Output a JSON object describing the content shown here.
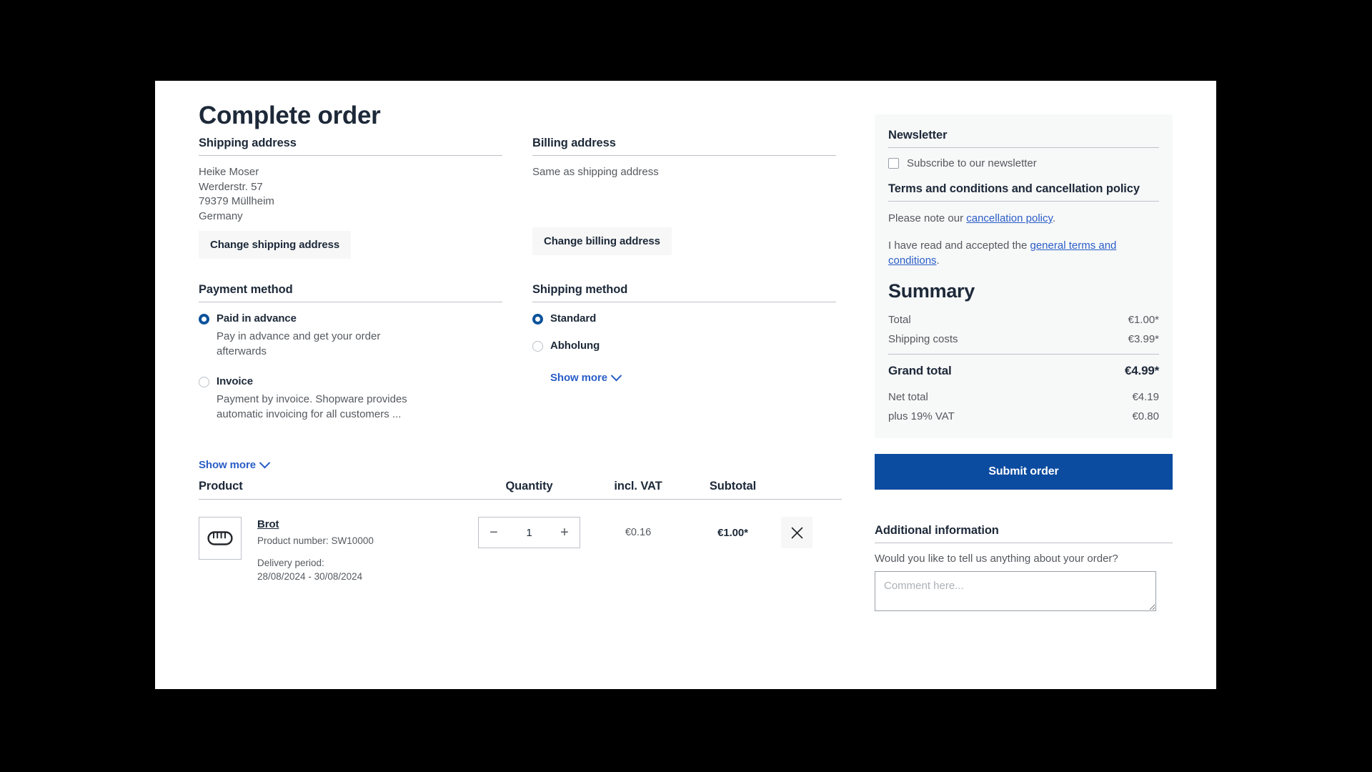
{
  "page": {
    "title": "Complete order"
  },
  "shipping_address": {
    "heading": "Shipping address",
    "lines": [
      "Heike Moser",
      "Werderstr. 57",
      "79379 Müllheim",
      "Germany"
    ],
    "change_button": "Change shipping address"
  },
  "billing_address": {
    "heading": "Billing address",
    "text": "Same as shipping address",
    "change_button": "Change billing address"
  },
  "payment_method": {
    "heading": "Payment method",
    "options": [
      {
        "label": "Paid in advance",
        "description": "Pay in advance and get your order afterwards",
        "selected": true
      },
      {
        "label": "Invoice",
        "description": "Payment by invoice. Shopware provides automatic invoicing for all customers ...",
        "selected": false
      }
    ],
    "show_more": "Show more"
  },
  "shipping_method": {
    "heading": "Shipping method",
    "options": [
      {
        "label": "Standard",
        "selected": true
      },
      {
        "label": "Abholung",
        "selected": false
      }
    ],
    "show_more": "Show more"
  },
  "product_table": {
    "columns": {
      "product": "Product",
      "quantity": "Quantity",
      "vat": "incl. VAT",
      "subtotal": "Subtotal"
    },
    "rows": [
      {
        "icon": "bread-loaf-icon",
        "name": "Brot",
        "product_number": "Product number: SW10000",
        "delivery_period": "Delivery period: 28/08/2024 - 30/08/2024",
        "quantity": "1",
        "decrease_label": "−",
        "increase_label": "+",
        "vat": "€0.16",
        "subtotal": "€1.00*",
        "remove_label": "✕"
      }
    ]
  },
  "newsletter": {
    "heading": "Newsletter",
    "checkbox_label": "Subscribe to our newsletter",
    "checked": false
  },
  "terms": {
    "heading": "Terms and conditions and cancellation policy",
    "note_prefix": "Please note our ",
    "note_link": "cancellation policy",
    "note_suffix": ".",
    "accept_prefix": "I have read and accepted the ",
    "accept_link": "general terms and conditions",
    "accept_suffix": "."
  },
  "summary": {
    "title": "Summary",
    "rows": [
      {
        "label": "Total",
        "value": "€1.00*"
      },
      {
        "label": "Shipping costs",
        "value": "€3.99*"
      }
    ],
    "grand": {
      "label": "Grand total",
      "value": "€4.99*"
    },
    "after_rows": [
      {
        "label": "Net total",
        "value": "€4.19"
      },
      {
        "label": "plus 19% VAT",
        "value": "€0.80"
      }
    ]
  },
  "submit": {
    "label": "Submit order"
  },
  "additional_information": {
    "heading": "Additional information",
    "question": "Would you like to tell us anything about your order?",
    "comment_placeholder": "Comment here...",
    "comment_value": ""
  },
  "colors": {
    "accent_blue": "#0b4ba0",
    "link_blue": "#2a5ec7",
    "radio_blue": "#0b539b",
    "text_dark": "#1d2939",
    "text_muted": "#55595e",
    "rule": "#bcc1c7",
    "panel_bg": "#f7f8f8",
    "button_grey": "#f7f7f7",
    "page_bg": "#000000"
  }
}
